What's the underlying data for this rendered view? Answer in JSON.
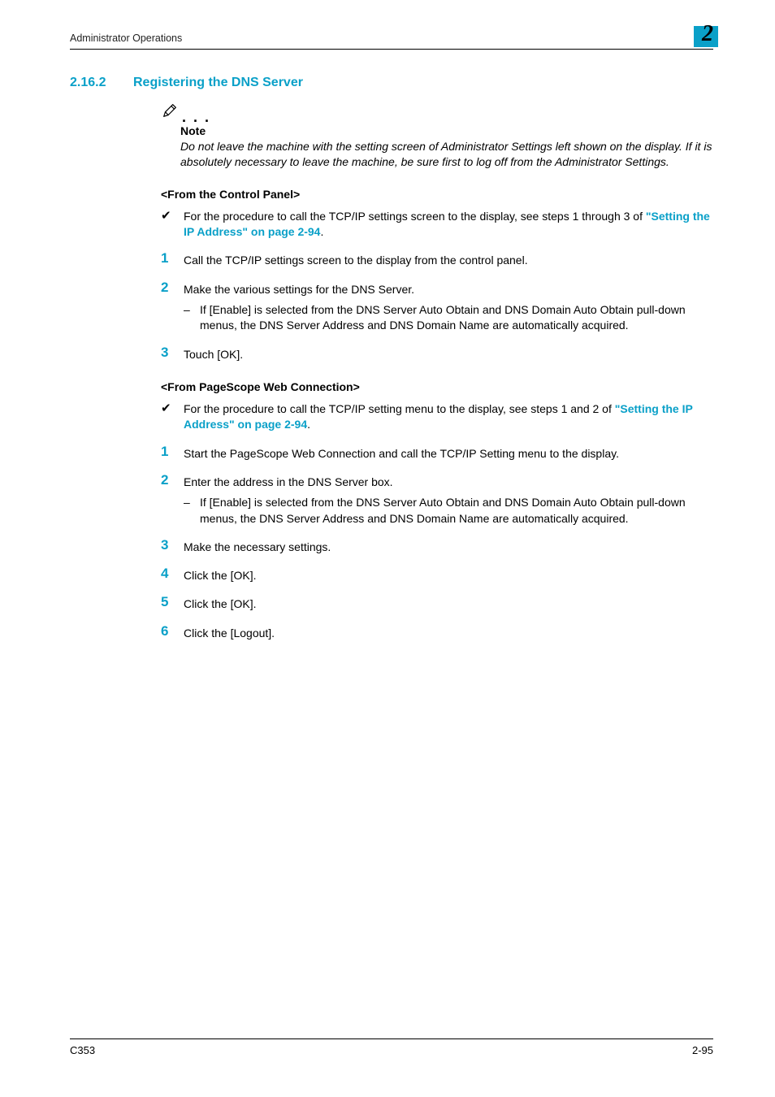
{
  "header": {
    "running_head": "Administrator Operations",
    "chapter_number": "2"
  },
  "section": {
    "number": "2.16.2",
    "title": "Registering the DNS Server"
  },
  "note": {
    "dots": ". . .",
    "label": "Note",
    "text": "Do not leave the machine with the setting screen of Administrator Settings left shown on the display. If it is absolutely necessary to leave the machine, be sure first to log off from the Administrator Settings.",
    "icon_name": "pencil-note-icon"
  },
  "panel": {
    "heading": "<From the Control Panel>",
    "bullet": {
      "mark": "✔",
      "text_before_link": "For the procedure to call the TCP/IP settings screen to the display, see steps 1 through 3 of ",
      "link_text": "\"Setting the IP Address\" on page 2-94",
      "text_after_link": "."
    },
    "steps": [
      {
        "n": "1",
        "text": "Call the TCP/IP settings screen to the display from the control panel.",
        "subs": []
      },
      {
        "n": "2",
        "text": "Make the various settings for the DNS Server.",
        "subs": [
          {
            "dash": "–",
            "text": "If [Enable] is selected from the DNS Server Auto Obtain and DNS Domain Auto Obtain pull-down menus, the DNS Server Address and DNS Domain Name are automatically acquired."
          }
        ]
      },
      {
        "n": "3",
        "text": "Touch [OK].",
        "subs": []
      }
    ]
  },
  "web": {
    "heading": "<From PageScope Web Connection>",
    "bullet": {
      "mark": "✔",
      "text_before_link": "For the procedure to call the TCP/IP setting menu to the display, see steps 1 and 2 of ",
      "link_text": "\"Setting the IP Address\" on page 2-94",
      "text_after_link": "."
    },
    "steps": [
      {
        "n": "1",
        "text": "Start the PageScope Web Connection and call the TCP/IP Setting menu to the display.",
        "subs": []
      },
      {
        "n": "2",
        "text": "Enter the address in the DNS Server box.",
        "subs": [
          {
            "dash": "–",
            "text": "If [Enable] is selected from the DNS Server Auto Obtain and DNS Domain Auto Obtain pull-down menus, the DNS Server Address and DNS Domain Name are automatically acquired."
          }
        ]
      },
      {
        "n": "3",
        "text": "Make the necessary settings.",
        "subs": []
      },
      {
        "n": "4",
        "text": "Click the [OK].",
        "subs": []
      },
      {
        "n": "5",
        "text": "Click the [OK].",
        "subs": []
      },
      {
        "n": "6",
        "text": "Click the [Logout].",
        "subs": []
      }
    ]
  },
  "footer": {
    "left": "C353",
    "right": "2-95"
  }
}
